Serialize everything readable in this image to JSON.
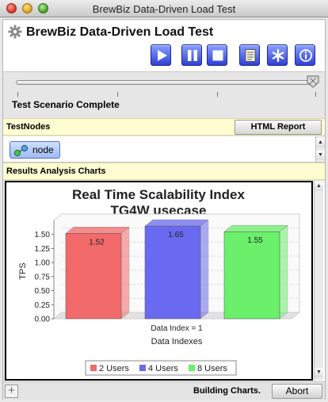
{
  "window": {
    "title": "BrewBiz Data-Driven Load Test"
  },
  "header": {
    "app_title": "BrewBiz Data-Driven Load Test",
    "app_icon": "gear-icon",
    "toolbar": [
      {
        "name": "play-button",
        "icon": "play-icon"
      },
      {
        "name": "pause-button",
        "icon": "pause-icon"
      },
      {
        "name": "stop-button",
        "icon": "stop-icon"
      },
      {
        "name": "document-button",
        "icon": "document-icon"
      },
      {
        "name": "settings-button",
        "icon": "asterisk-icon"
      },
      {
        "name": "info-button",
        "icon": "info-icon"
      }
    ],
    "accent_color": "#3b4de3"
  },
  "progress": {
    "value": 1.0,
    "status": "Test Scenario Complete"
  },
  "testnodes": {
    "section_label": "TestNodes",
    "report_button_label": "HTML Report",
    "nodes": [
      {
        "label": "node",
        "icon": "node-icon"
      }
    ]
  },
  "results": {
    "section_label": "Results Analysis Charts"
  },
  "chart_data": {
    "type": "bar",
    "title": "Real Time Scalability Index",
    "subtitle": "TG4W usecase",
    "xlabel": "Data Indexes",
    "ylabel": "TPS",
    "categories": [
      "Data Index = 1"
    ],
    "series": [
      {
        "name": "2 Users",
        "values": [
          1.52
        ],
        "color": "#f26a6a"
      },
      {
        "name": "4 Users",
        "values": [
          1.65
        ],
        "color": "#6a6af0"
      },
      {
        "name": "8 Users",
        "values": [
          1.55
        ],
        "color": "#6af06a"
      }
    ],
    "ylim": [
      0,
      1.75
    ],
    "yticks": [
      "0.00",
      "0.25",
      "0.50",
      "0.75",
      "1.00",
      "1.25",
      "1.50"
    ],
    "grid": true,
    "legend_position": "bottom",
    "three_d": true
  },
  "footer": {
    "status": "Building Charts.",
    "abort_label": "Abort"
  }
}
